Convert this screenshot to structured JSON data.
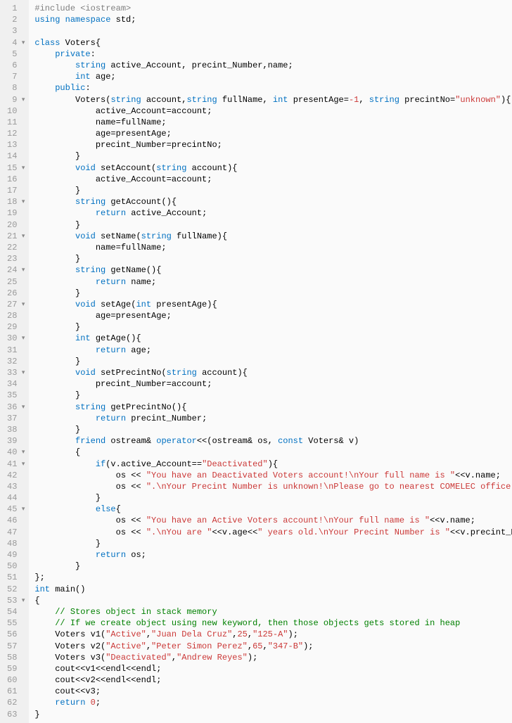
{
  "lines": [
    {
      "n": "1",
      "f": "",
      "html": "<span class='pp'>#include &lt;iostream&gt;</span>"
    },
    {
      "n": "2",
      "f": "",
      "html": "<span class='kw'>using</span> <span class='kw'>namespace</span> std;"
    },
    {
      "n": "3",
      "f": "",
      "html": ""
    },
    {
      "n": "4",
      "f": "▾",
      "html": "<span class='kw'>class</span> Voters{"
    },
    {
      "n": "5",
      "f": "",
      "html": "    <span class='kw'>private</span>:"
    },
    {
      "n": "6",
      "f": "",
      "html": "        <span class='ty'>string</span> active_Account, precint_Number,name;"
    },
    {
      "n": "7",
      "f": "",
      "html": "        <span class='ty'>int</span> age;"
    },
    {
      "n": "8",
      "f": "",
      "html": "    <span class='kw'>public</span>:"
    },
    {
      "n": "9",
      "f": "▾",
      "html": "        Voters(<span class='ty'>string</span> account,<span class='ty'>string</span> fullName, <span class='ty'>int</span> presentAge=<span class='num'>-1</span>, <span class='ty'>string</span> precintNo=<span class='str'>\"unknown\"</span>){"
    },
    {
      "n": "10",
      "f": "",
      "html": "            active_Account=account;"
    },
    {
      "n": "11",
      "f": "",
      "html": "            name=fullName;"
    },
    {
      "n": "12",
      "f": "",
      "html": "            age=presentAge;"
    },
    {
      "n": "13",
      "f": "",
      "html": "            precint_Number=precintNo;"
    },
    {
      "n": "14",
      "f": "",
      "html": "        }"
    },
    {
      "n": "15",
      "f": "▾",
      "html": "        <span class='ty'>void</span> setAccount(<span class='ty'>string</span> account){"
    },
    {
      "n": "16",
      "f": "",
      "html": "            active_Account=account;"
    },
    {
      "n": "17",
      "f": "",
      "html": "        }"
    },
    {
      "n": "18",
      "f": "▾",
      "html": "        <span class='ty'>string</span> getAccount(){"
    },
    {
      "n": "19",
      "f": "",
      "html": "            <span class='kw'>return</span> active_Account;"
    },
    {
      "n": "20",
      "f": "",
      "html": "        }"
    },
    {
      "n": "21",
      "f": "▾",
      "html": "        <span class='ty'>void</span> setName(<span class='ty'>string</span> fullName){"
    },
    {
      "n": "22",
      "f": "",
      "html": "            name=fullName;"
    },
    {
      "n": "23",
      "f": "",
      "html": "        }"
    },
    {
      "n": "24",
      "f": "▾",
      "html": "        <span class='ty'>string</span> getName(){"
    },
    {
      "n": "25",
      "f": "",
      "html": "            <span class='kw'>return</span> name;"
    },
    {
      "n": "26",
      "f": "",
      "html": "        }"
    },
    {
      "n": "27",
      "f": "▾",
      "html": "        <span class='ty'>void</span> setAge(<span class='ty'>int</span> presentAge){"
    },
    {
      "n": "28",
      "f": "",
      "html": "            age=presentAge;"
    },
    {
      "n": "29",
      "f": "",
      "html": "        }"
    },
    {
      "n": "30",
      "f": "▾",
      "html": "        <span class='ty'>int</span> getAge(){"
    },
    {
      "n": "31",
      "f": "",
      "html": "            <span class='kw'>return</span> age;"
    },
    {
      "n": "32",
      "f": "",
      "html": "        }"
    },
    {
      "n": "33",
      "f": "▾",
      "html": "        <span class='ty'>void</span> setPrecintNo(<span class='ty'>string</span> account){"
    },
    {
      "n": "34",
      "f": "",
      "html": "            precint_Number=account;"
    },
    {
      "n": "35",
      "f": "",
      "html": "        }"
    },
    {
      "n": "36",
      "f": "▾",
      "html": "        <span class='ty'>string</span> getPrecintNo(){"
    },
    {
      "n": "37",
      "f": "",
      "html": "            <span class='kw'>return</span> precint_Number;"
    },
    {
      "n": "38",
      "f": "",
      "html": "        }"
    },
    {
      "n": "39",
      "f": "",
      "html": "        <span class='kw'>friend</span> ostream&amp; <span class='kw'>operator</span>&lt;&lt;(ostream&amp; os, <span class='kw'>const</span> Voters&amp; v)"
    },
    {
      "n": "40",
      "f": "▾",
      "html": "        {"
    },
    {
      "n": "41",
      "f": "▾",
      "html": "            <span class='kw'>if</span>(v.active_Account==<span class='str'>\"Deactivated\"</span>){"
    },
    {
      "n": "42",
      "f": "",
      "html": "                os &lt;&lt; <span class='str'>\"You have an Deactivated Voters account!\\nYour full name is \"</span>&lt;&lt;v.name;"
    },
    {
      "n": "43",
      "f": "",
      "html": "                os &lt;&lt; <span class='str'>\".\\nYour Precint Number is unknown!\\nPlease go to nearest COMELEC office.\\n\"</span>;"
    },
    {
      "n": "44",
      "f": "",
      "html": "            }"
    },
    {
      "n": "45",
      "f": "▾",
      "html": "            <span class='kw'>else</span>{"
    },
    {
      "n": "46",
      "f": "",
      "html": "                os &lt;&lt; <span class='str'>\"You have an Active Voters account!\\nYour full name is \"</span>&lt;&lt;v.name;"
    },
    {
      "n": "47",
      "f": "",
      "html": "                os &lt;&lt; <span class='str'>\".\\nYou are \"</span>&lt;&lt;v.age&lt;&lt;<span class='str'>\" years old.\\nYour Precint Number is \"</span>&lt;&lt;v.precint_Number&lt;&lt;<span class='str'>\".\"</span>;"
    },
    {
      "n": "48",
      "f": "",
      "html": "            }"
    },
    {
      "n": "49",
      "f": "",
      "html": "            <span class='kw'>return</span> os;"
    },
    {
      "n": "50",
      "f": "",
      "html": "        }"
    },
    {
      "n": "51",
      "f": "",
      "html": "};"
    },
    {
      "n": "52",
      "f": "",
      "html": "<span class='ty'>int</span> main()"
    },
    {
      "n": "53",
      "f": "▾",
      "html": "{"
    },
    {
      "n": "54",
      "f": "",
      "html": "    <span class='cmt'>// Stores object in stack memory</span>"
    },
    {
      "n": "55",
      "f": "",
      "html": "    <span class='cmt'>// If we create object using new keyword, then those objects gets stored in heap</span>"
    },
    {
      "n": "56",
      "f": "",
      "html": "    Voters v1(<span class='str'>\"Active\"</span>,<span class='str'>\"Juan Dela Cruz\"</span>,<span class='num'>25</span>,<span class='str'>\"125-A\"</span>);"
    },
    {
      "n": "57",
      "f": "",
      "html": "    Voters v2(<span class='str'>\"Active\"</span>,<span class='str'>\"Peter Simon Perez\"</span>,<span class='num'>65</span>,<span class='str'>\"347-B\"</span>);"
    },
    {
      "n": "58",
      "f": "",
      "html": "    Voters v3(<span class='str'>\"Deactivated\"</span>,<span class='str'>\"Andrew Reyes\"</span>);"
    },
    {
      "n": "59",
      "f": "",
      "html": "    cout&lt;&lt;v1&lt;&lt;endl&lt;&lt;endl;"
    },
    {
      "n": "60",
      "f": "",
      "html": "    cout&lt;&lt;v2&lt;&lt;endl&lt;&lt;endl;"
    },
    {
      "n": "61",
      "f": "",
      "html": "    cout&lt;&lt;v3;"
    },
    {
      "n": "62",
      "f": "",
      "html": "    <span class='kw'>return</span> <span class='num'>0</span>;"
    },
    {
      "n": "63",
      "f": "",
      "html": "}"
    }
  ]
}
